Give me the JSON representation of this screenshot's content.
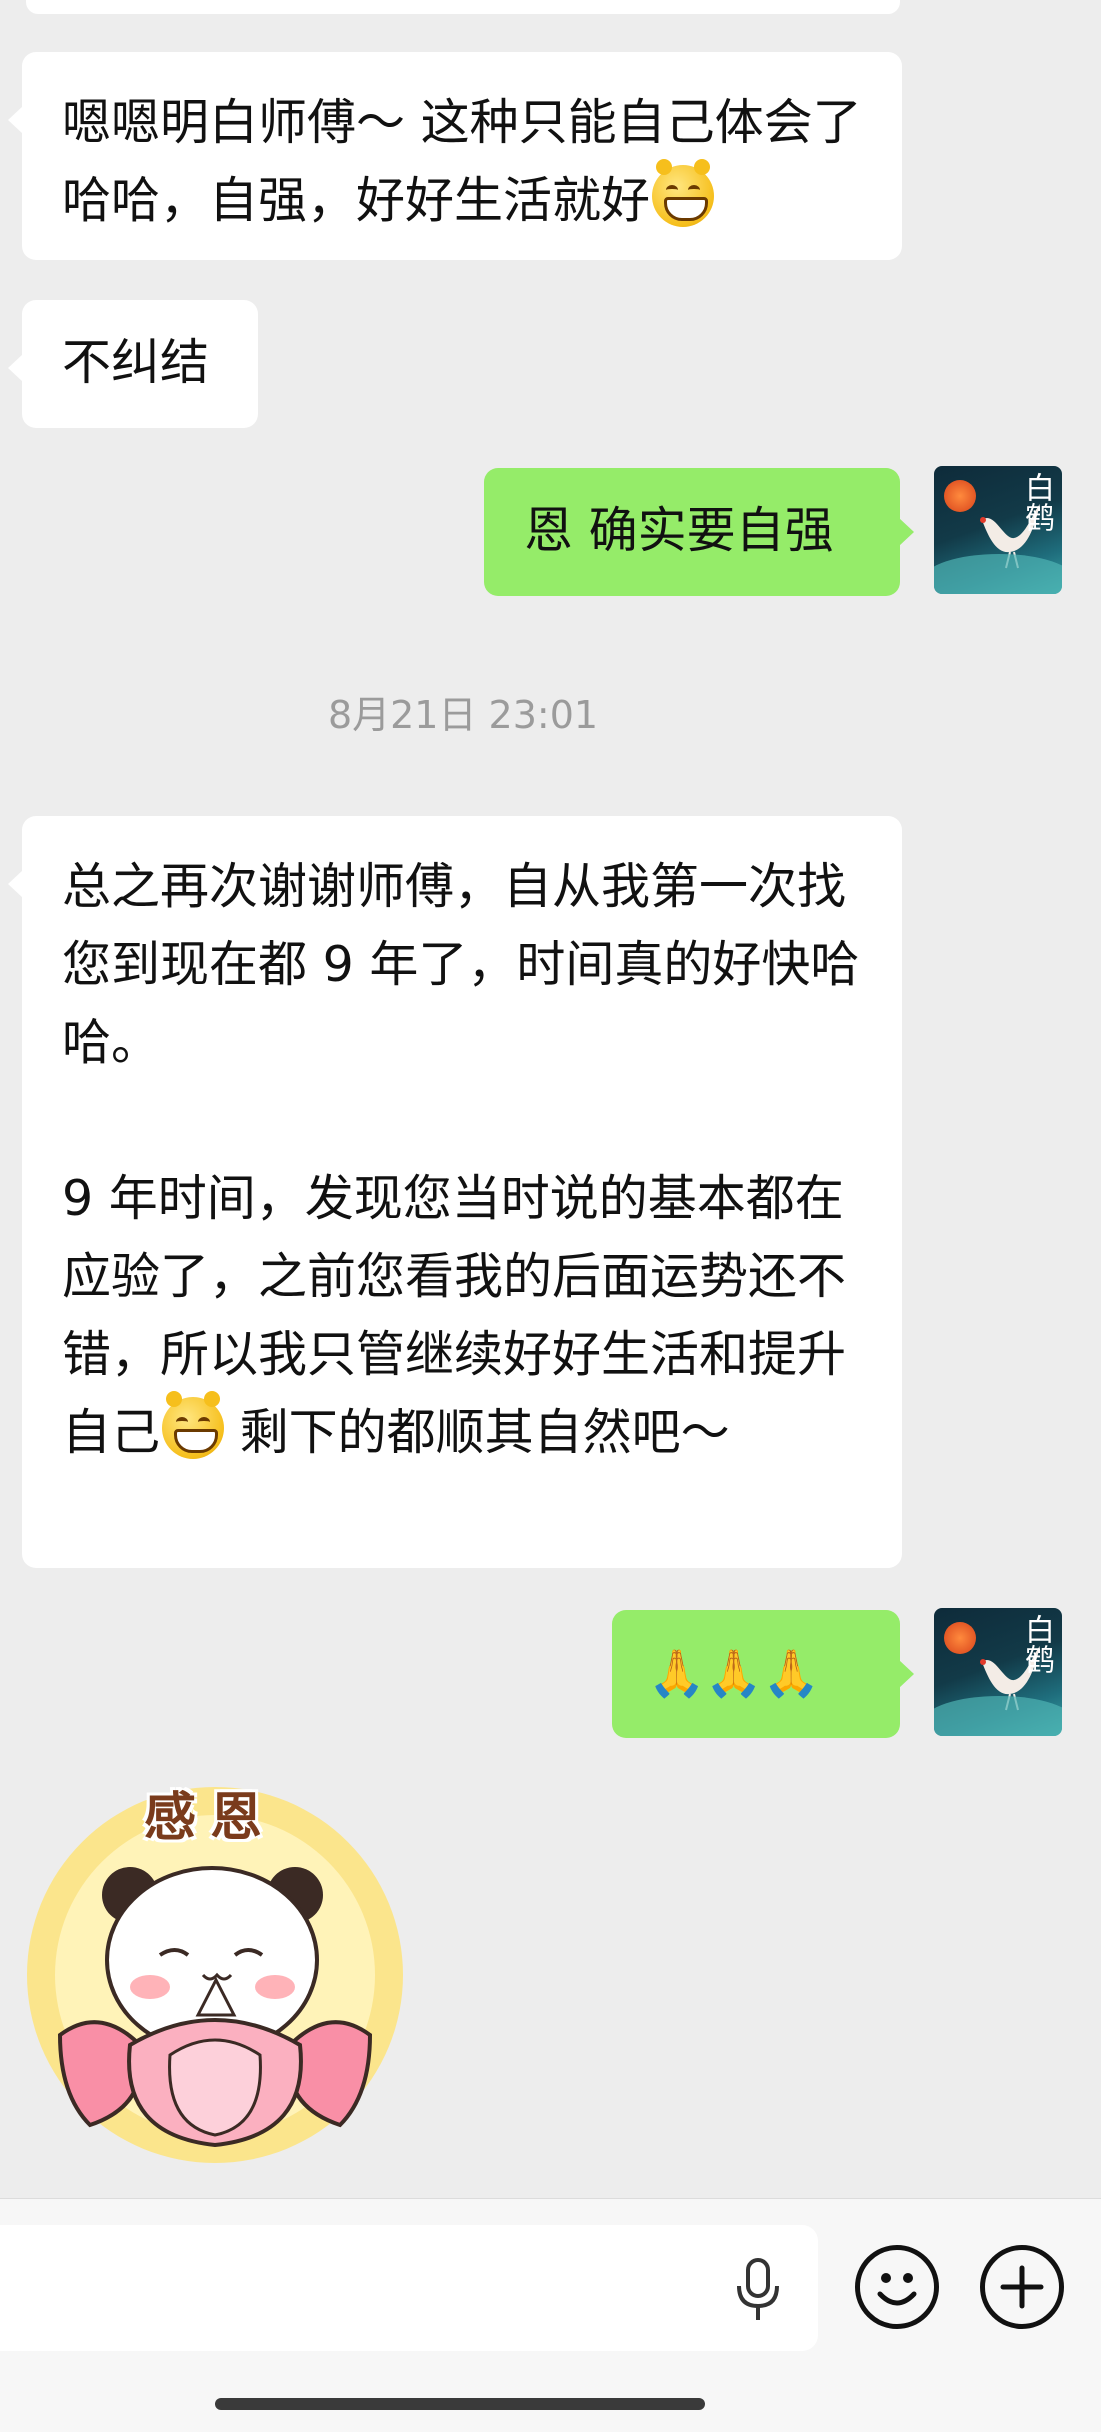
{
  "messages": [
    {
      "side": "in",
      "text": "嗯嗯明白师傅～ 这种只能自己体会了哈哈，自强，好好生活就好",
      "emoji": "grinning-cat-emoji"
    },
    {
      "side": "in",
      "text": "不纠结"
    },
    {
      "side": "out",
      "text": "恩 确实要自强"
    },
    {
      "side": "in",
      "text": "总之再次谢谢师傅，自从我第一次找您到现在都 9 年了，时间真的好快哈哈。\n\n9 年时间，发现您当时说的基本都在应验了，之前您看我的后面运势还不错，所以我只管继续好好生活和提升自己",
      "emoji": "grinning-cat-emoji",
      "text_after": " 剩下的都顺其自然吧～"
    },
    {
      "side": "out",
      "text": "🙏🙏🙏"
    }
  ],
  "timestamp": "8月21日 23:01",
  "avatar": {
    "text": "白鹤",
    "icon": "crane-avatar-icon"
  },
  "sticker": {
    "label": "感恩",
    "icon": "panda-lotus-sticker"
  },
  "input": {
    "value": "",
    "placeholder": ""
  },
  "icons": {
    "mic": "microphone-icon",
    "emoji": "emoji-face-icon",
    "plus": "plus-icon"
  },
  "colors": {
    "background": "#ededed",
    "incoming_bubble": "#ffffff",
    "outgoing_bubble": "#95ec69",
    "timestamp": "#9b9b9b"
  }
}
